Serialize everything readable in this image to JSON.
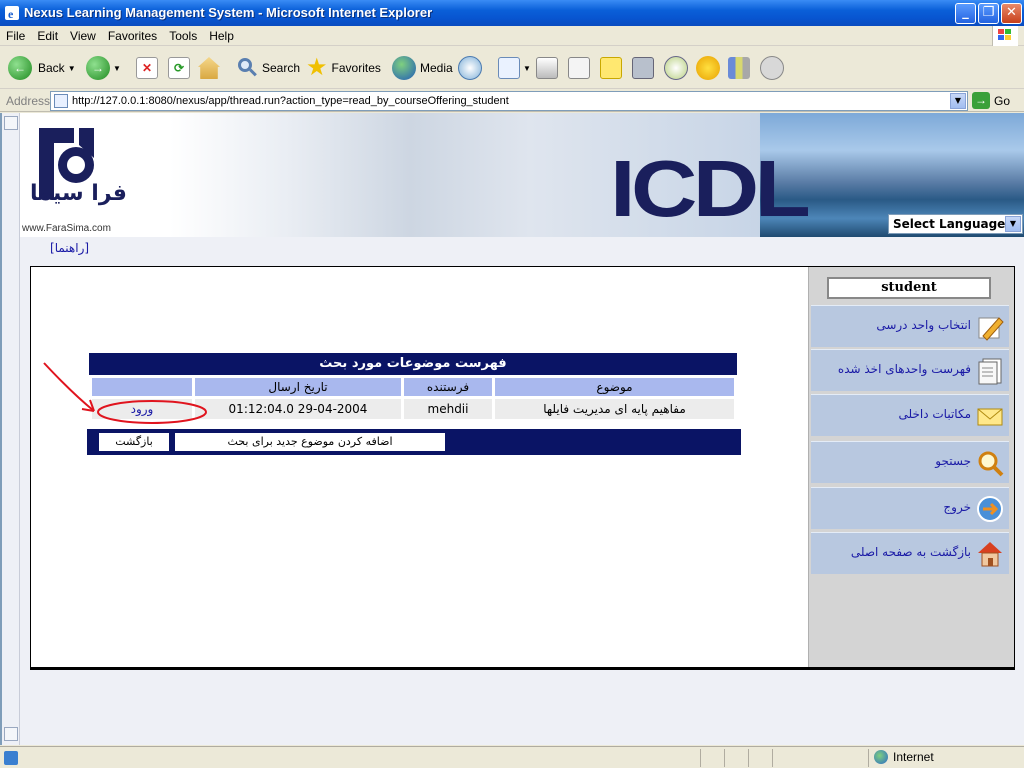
{
  "window": {
    "title": "Nexus Learning Management System - Microsoft Internet Explorer"
  },
  "menu": [
    "File",
    "Edit",
    "View",
    "Favorites",
    "Tools",
    "Help"
  ],
  "toolbar": {
    "back": "Back",
    "search": "Search",
    "favorites": "Favorites",
    "media": "Media"
  },
  "address": {
    "label": "Address",
    "url": "http://127.0.0.1:8080/nexus/app/thread.run?action_type=read_by_courseOffering_student",
    "go": "Go"
  },
  "banner": {
    "brand": "ICDL",
    "logo_text": "فرا سیما",
    "site": "www.FaraSima.com",
    "language_select": "Select Language"
  },
  "help_link": "[راهنما]",
  "sidebar": {
    "user": "student",
    "items": [
      {
        "label": "انتخاب واحد درسی",
        "icon": "pencil-paper-icon"
      },
      {
        "label": "فهرست واحدهای اخذ شده",
        "icon": "document-list-icon"
      },
      {
        "label": "مکاتبات داخلی",
        "icon": "envelope-icon"
      },
      {
        "label": "جستجو",
        "icon": "magnifier-icon"
      },
      {
        "label": "خروج",
        "icon": "exit-icon"
      },
      {
        "label": "بازگشت به صفحه اصلی",
        "icon": "home-icon"
      }
    ]
  },
  "topics": {
    "title": "فهرست موضوعات مورد بحث",
    "columns": [
      "",
      "تاریخ ارسال",
      "فرستنده",
      "موضوع"
    ],
    "rows": [
      {
        "action": "ورود",
        "date": "01:12:04.0 29-04-2004",
        "sender": "mehdii",
        "subject": "مفاهیم پایه ای مدیریت فایلها"
      }
    ],
    "add_button": "اضافه کردن موضوع جدید برای بحث",
    "back_button": "بازگشت"
  },
  "status": {
    "zone": "Internet"
  },
  "colors": {
    "title_bar": "#0a5fd8",
    "table_header": "#0a1465",
    "column_header": "#a9b8ee",
    "sidebar_item": "#b8c8e0",
    "annotation": "#e0141e"
  }
}
